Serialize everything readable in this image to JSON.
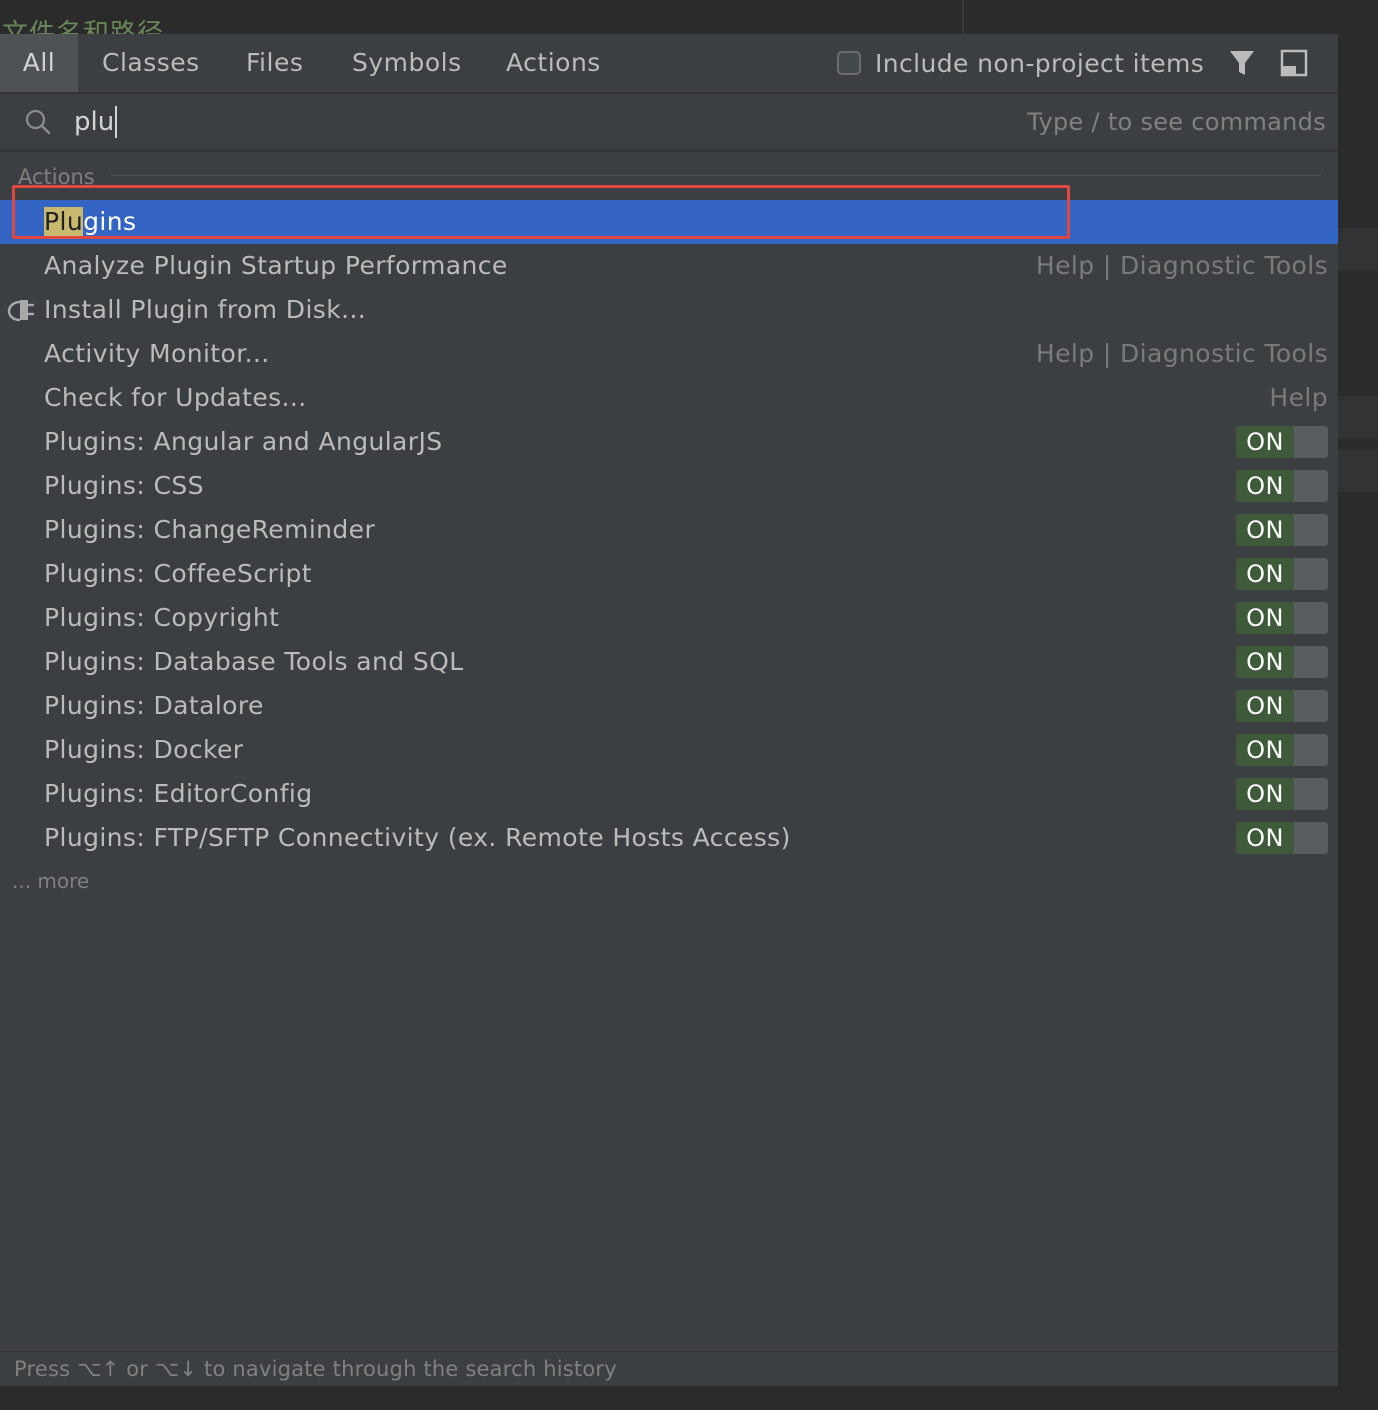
{
  "background": {
    "editor_text": "文件名和路径"
  },
  "tabs": [
    {
      "label": "All",
      "active": true
    },
    {
      "label": "Classes",
      "active": false
    },
    {
      "label": "Files",
      "active": false
    },
    {
      "label": "Symbols",
      "active": false
    },
    {
      "label": "Actions",
      "active": false
    }
  ],
  "options": {
    "include_non_project_label": "Include non-project items",
    "include_non_project_checked": false,
    "filter_icon": "filter-icon",
    "preview_icon": "preview-panel-icon"
  },
  "search": {
    "value": "plu",
    "hint": "Type / to see commands",
    "icon": "search-icon"
  },
  "section": {
    "title": "Actions"
  },
  "results": [
    {
      "label": "Plugins",
      "match": "Plu",
      "rest": "gins",
      "selected": true
    },
    {
      "label": "Analyze Plugin Startup Performance",
      "location": "Help | Diagnostic Tools"
    },
    {
      "label": "Install Plugin from Disk...",
      "icon": "plugin-icon"
    },
    {
      "label": "Activity Monitor...",
      "location": "Help | Diagnostic Tools"
    },
    {
      "label": "Check for Updates...",
      "location": "Help"
    },
    {
      "label": "Plugins: Angular and AngularJS",
      "toggle": "ON"
    },
    {
      "label": "Plugins: CSS",
      "toggle": "ON"
    },
    {
      "label": "Plugins: ChangeReminder",
      "toggle": "ON"
    },
    {
      "label": "Plugins: CoffeeScript",
      "toggle": "ON"
    },
    {
      "label": "Plugins: Copyright",
      "toggle": "ON"
    },
    {
      "label": "Plugins: Database Tools and SQL",
      "toggle": "ON"
    },
    {
      "label": "Plugins: Datalore",
      "toggle": "ON"
    },
    {
      "label": "Plugins: Docker",
      "toggle": "ON"
    },
    {
      "label": "Plugins: EditorConfig",
      "toggle": "ON"
    },
    {
      "label": "Plugins: FTP/SFTP Connectivity (ex. Remote Hosts Access)",
      "toggle": "ON"
    }
  ],
  "more_label": "... more",
  "footer": {
    "hint": "Press ⌥↑ or ⌥↓ to navigate through the search history"
  },
  "colors": {
    "selection": "#3565c4",
    "highlight_box": "#e0483f",
    "toggle_on": "#3e5a3a",
    "popup_bg": "#3c3f41"
  }
}
